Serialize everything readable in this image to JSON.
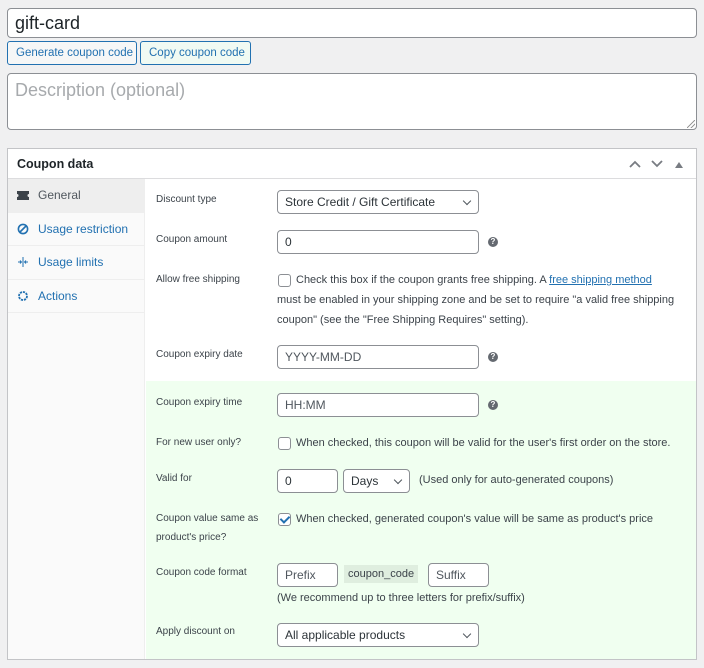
{
  "coupon": {
    "title_value": "gift-card",
    "generate_button": "Generate coupon code",
    "copy_button": "Copy coupon code",
    "description_placeholder": "Description (optional)"
  },
  "panel": {
    "title": "Coupon data",
    "controls": {
      "move_up": "^",
      "move_down": "v",
      "toggle": "▲"
    },
    "tabs": [
      {
        "label": "General",
        "icon": "ticket-icon",
        "active": true
      },
      {
        "label": "Usage restriction",
        "icon": "block-icon",
        "active": false
      },
      {
        "label": "Usage limits",
        "icon": "limits-icon",
        "active": false
      },
      {
        "label": "Actions",
        "icon": "gear-icon",
        "active": false
      }
    ]
  },
  "general": {
    "discount_type": {
      "label": "Discount type",
      "value": "Store Credit / Gift Certificate"
    },
    "coupon_amount": {
      "label": "Coupon amount",
      "value": "0"
    },
    "free_shipping": {
      "label": "Allow free shipping",
      "checked": false,
      "text_before": "Check this box if the coupon grants free shipping. A ",
      "link": "free shipping method",
      "line2": "must be enabled in your shipping zone and be set to require \"a valid free shipping",
      "line3": "coupon\" (see the \"Free Shipping Requires\" setting)."
    },
    "expiry_date": {
      "label": "Coupon expiry date",
      "placeholder": "YYYY-MM-DD"
    },
    "expiry_time": {
      "label": "Coupon expiry time",
      "placeholder": "HH:MM"
    },
    "new_user": {
      "label": "For new user only?",
      "checked": false,
      "text": "When checked, this coupon will be valid for the user's first order on the store."
    },
    "valid_for": {
      "label": "Valid for",
      "value": "0",
      "unit": "Days",
      "note": "(Used only for auto-generated coupons)"
    },
    "same_value": {
      "label_line1": "Coupon value same as",
      "label_line2": "product's price?",
      "checked": true,
      "text": "When checked, generated coupon's value will be same as product's price"
    },
    "code_format": {
      "label": "Coupon code format",
      "prefix_placeholder": "Prefix",
      "code": "coupon_code",
      "suffix_placeholder": "Suffix",
      "note": "(We recommend up to three letters for prefix/suffix)"
    },
    "apply_discount": {
      "label": "Apply discount on",
      "value": "All applicable products"
    }
  },
  "help_icon": "?"
}
